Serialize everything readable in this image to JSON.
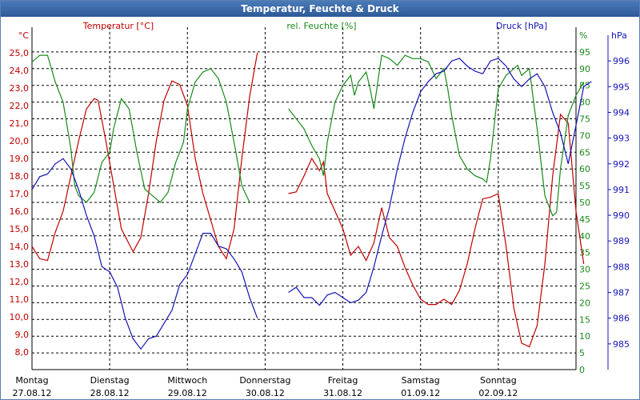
{
  "title": "Temperatur, Feuchte & Druck",
  "colors": {
    "temperature": "#c00000",
    "humidity": "#1a8a1a",
    "pressure": "#1414b4",
    "grid": "#000000",
    "text": "#000000"
  },
  "chart_data": {
    "type": "line",
    "title": "Temperatur, Feuchte & Druck",
    "x_categories": [
      {
        "day": "Montag",
        "date": "27.08.12"
      },
      {
        "day": "Dienstag",
        "date": "28.08.12"
      },
      {
        "day": "Mittwoch",
        "date": "29.08.12"
      },
      {
        "day": "Donnerstag",
        "date": "30.08.12"
      },
      {
        "day": "Freitag",
        "date": "31.08.12"
      },
      {
        "day": "Samstag",
        "date": "01.09.12"
      },
      {
        "day": "Sonntag",
        "date": "02.09.12"
      }
    ],
    "x_unit": "days since Montag 27.08.12 00:00",
    "axes": {
      "temperature": {
        "label": "Temperatur [°C]",
        "unit": "°C",
        "range": [
          7.0,
          26.0
        ],
        "ticks": [
          "8,0",
          "9,0",
          "10,0",
          "11,0",
          "12,0",
          "13,0",
          "14,0",
          "15,0",
          "16,0",
          "17,0",
          "18,0",
          "19,0",
          "20,0",
          "21,0",
          "22,0",
          "23,0",
          "24,0",
          "25,0"
        ]
      },
      "humidity": {
        "label": "rel. Feuchte [%]",
        "unit": "%",
        "range": [
          0,
          100
        ],
        "ticks": [
          "0",
          "5",
          "10",
          "15",
          "20",
          "25",
          "30",
          "35",
          "40",
          "45",
          "50",
          "55",
          "60",
          "65",
          "70",
          "75",
          "80",
          "85",
          "90",
          "95"
        ]
      },
      "pressure": {
        "label": "Druck [hPa]",
        "unit": "hPa",
        "range": [
          984.0,
          997.0
        ],
        "ticks": [
          "985",
          "986",
          "987",
          "988",
          "989",
          "990",
          "991",
          "992",
          "993",
          "994",
          "995",
          "996"
        ]
      }
    },
    "series": [
      {
        "name": "Temperatur [°C]",
        "axis": "temperature",
        "segments": [
          [
            [
              0,
              14.0
            ],
            [
              0.1,
              13.3
            ],
            [
              0.2,
              13.2
            ],
            [
              0.3,
              14.8
            ],
            [
              0.4,
              16.0
            ],
            [
              0.5,
              18.0
            ],
            [
              0.6,
              20.0
            ],
            [
              0.7,
              21.8
            ],
            [
              0.8,
              22.4
            ],
            [
              0.85,
              22.3
            ],
            [
              0.95,
              20.0
            ],
            [
              1.05,
              17.5
            ],
            [
              1.15,
              15.0
            ],
            [
              1.3,
              13.7
            ],
            [
              1.4,
              14.5
            ],
            [
              1.5,
              17.0
            ],
            [
              1.6,
              20.0
            ],
            [
              1.7,
              22.3
            ],
            [
              1.8,
              23.4
            ],
            [
              1.9,
              23.2
            ],
            [
              2.0,
              22.0
            ],
            [
              2.1,
              19.0
            ],
            [
              2.2,
              17.0
            ],
            [
              2.3,
              15.5
            ],
            [
              2.4,
              14.0
            ],
            [
              2.5,
              13.3
            ],
            [
              2.6,
              15.0
            ],
            [
              2.7,
              19.0
            ],
            [
              2.8,
              22.5
            ],
            [
              2.9,
              25.0
            ]
          ],
          [
            [
              3.3,
              17.0
            ],
            [
              3.4,
              17.1
            ],
            [
              3.5,
              18.0
            ],
            [
              3.6,
              19.0
            ],
            [
              3.7,
              18.3
            ],
            [
              3.75,
              18.8
            ],
            [
              3.8,
              17.0
            ],
            [
              3.9,
              16.0
            ],
            [
              4.0,
              15.0
            ],
            [
              4.1,
              13.5
            ],
            [
              4.2,
              14.0
            ],
            [
              4.3,
              13.2
            ],
            [
              4.4,
              14.2
            ],
            [
              4.5,
              16.2
            ],
            [
              4.6,
              14.5
            ],
            [
              4.7,
              14.0
            ],
            [
              4.8,
              12.8
            ],
            [
              4.9,
              11.8
            ],
            [
              5.0,
              11.0
            ],
            [
              5.1,
              10.7
            ],
            [
              5.2,
              10.7
            ],
            [
              5.3,
              11.0
            ],
            [
              5.4,
              10.7
            ],
            [
              5.5,
              11.5
            ],
            [
              5.6,
              13.0
            ],
            [
              5.7,
              15.0
            ],
            [
              5.8,
              16.7
            ],
            [
              5.9,
              16.8
            ],
            [
              6.0,
              17.0
            ],
            [
              6.1,
              14.0
            ],
            [
              6.2,
              10.5
            ],
            [
              6.3,
              8.5
            ],
            [
              6.4,
              8.3
            ],
            [
              6.5,
              9.5
            ],
            [
              6.6,
              13.0
            ],
            [
              6.7,
              18.0
            ],
            [
              6.8,
              21.5
            ],
            [
              6.9,
              21.0
            ],
            [
              7.0,
              16.0
            ],
            [
              7.1,
              13.0
            ]
          ]
        ]
      },
      {
        "name": "rel. Feuchte [%]",
        "axis": "humidity",
        "segments": [
          [
            [
              0,
              92
            ],
            [
              0.1,
              94
            ],
            [
              0.2,
              94
            ],
            [
              0.3,
              86
            ],
            [
              0.4,
              80
            ],
            [
              0.5,
              66
            ],
            [
              0.55,
              55
            ],
            [
              0.6,
              52
            ],
            [
              0.7,
              50
            ],
            [
              0.8,
              53
            ],
            [
              0.9,
              62
            ],
            [
              1.0,
              65
            ],
            [
              1.05,
              72
            ],
            [
              1.15,
              81
            ],
            [
              1.25,
              78
            ],
            [
              1.35,
              65
            ],
            [
              1.45,
              54
            ],
            [
              1.55,
              52
            ],
            [
              1.65,
              50
            ],
            [
              1.75,
              53
            ],
            [
              1.85,
              62
            ],
            [
              1.95,
              68
            ],
            [
              2.0,
              78
            ],
            [
              2.1,
              86
            ],
            [
              2.2,
              89
            ],
            [
              2.3,
              90
            ],
            [
              2.4,
              87
            ],
            [
              2.5,
              80
            ],
            [
              2.6,
              68
            ],
            [
              2.7,
              55
            ],
            [
              2.8,
              50
            ]
          ],
          [
            [
              3.3,
              78
            ],
            [
              3.4,
              75
            ],
            [
              3.5,
              72
            ],
            [
              3.6,
              67
            ],
            [
              3.7,
              63
            ],
            [
              3.75,
              58
            ],
            [
              3.8,
              68
            ],
            [
              3.9,
              80
            ],
            [
              4.0,
              85
            ],
            [
              4.1,
              88
            ],
            [
              4.15,
              82
            ],
            [
              4.2,
              86
            ],
            [
              4.3,
              89
            ],
            [
              4.35,
              84
            ],
            [
              4.4,
              78
            ],
            [
              4.5,
              94
            ],
            [
              4.6,
              93
            ],
            [
              4.7,
              91
            ],
            [
              4.8,
              94
            ],
            [
              4.9,
              93
            ],
            [
              5.0,
              93
            ],
            [
              5.1,
              92
            ],
            [
              5.2,
              87
            ],
            [
              5.3,
              90
            ],
            [
              5.35,
              84
            ],
            [
              5.4,
              76
            ],
            [
              5.5,
              64
            ],
            [
              5.6,
              60
            ],
            [
              5.7,
              58
            ],
            [
              5.8,
              57
            ],
            [
              5.85,
              56
            ],
            [
              5.9,
              63
            ],
            [
              6.0,
              84
            ],
            [
              6.1,
              88
            ],
            [
              6.2,
              90
            ],
            [
              6.25,
              91
            ],
            [
              6.3,
              88
            ],
            [
              6.4,
              90
            ],
            [
              6.5,
              72
            ],
            [
              6.6,
              52
            ],
            [
              6.7,
              46
            ],
            [
              6.75,
              47
            ],
            [
              6.8,
              60
            ],
            [
              6.9,
              76
            ],
            [
              7.0,
              82
            ],
            [
              7.1,
              86
            ]
          ]
        ]
      },
      {
        "name": "Druck [hPa]",
        "axis": "pressure",
        "segments": [
          [
            [
              0,
              991.0
            ],
            [
              0.1,
              991.5
            ],
            [
              0.2,
              991.6
            ],
            [
              0.3,
              992.0
            ],
            [
              0.4,
              992.2
            ],
            [
              0.5,
              991.8
            ],
            [
              0.6,
              991.0
            ],
            [
              0.7,
              990.0
            ],
            [
              0.8,
              989.2
            ],
            [
              0.9,
              988.0
            ],
            [
              1.0,
              987.8
            ],
            [
              1.1,
              987.2
            ],
            [
              1.2,
              986.0
            ],
            [
              1.3,
              985.2
            ],
            [
              1.4,
              984.8
            ],
            [
              1.5,
              985.2
            ],
            [
              1.6,
              985.3
            ],
            [
              1.7,
              985.8
            ],
            [
              1.8,
              986.3
            ],
            [
              1.9,
              987.3
            ],
            [
              2.0,
              987.7
            ],
            [
              2.1,
              988.5
            ],
            [
              2.2,
              989.3
            ],
            [
              2.3,
              989.3
            ],
            [
              2.4,
              988.8
            ],
            [
              2.5,
              988.7
            ],
            [
              2.6,
              988.3
            ],
            [
              2.7,
              987.8
            ],
            [
              2.8,
              986.8
            ],
            [
              2.9,
              986.0
            ]
          ],
          [
            [
              3.3,
              987.0
            ],
            [
              3.4,
              987.2
            ],
            [
              3.5,
              986.8
            ],
            [
              3.6,
              986.8
            ],
            [
              3.7,
              986.5
            ],
            [
              3.8,
              986.9
            ],
            [
              3.9,
              987.0
            ],
            [
              4.0,
              986.8
            ],
            [
              4.1,
              986.6
            ],
            [
              4.2,
              986.7
            ],
            [
              4.3,
              987.0
            ],
            [
              4.4,
              988.0
            ],
            [
              4.5,
              989.2
            ],
            [
              4.6,
              990.3
            ],
            [
              4.7,
              991.8
            ],
            [
              4.8,
              993.0
            ],
            [
              4.9,
              994.0
            ],
            [
              5.0,
              994.8
            ],
            [
              5.1,
              995.2
            ],
            [
              5.2,
              995.5
            ],
            [
              5.3,
              995.6
            ],
            [
              5.4,
              996.0
            ],
            [
              5.5,
              996.1
            ],
            [
              5.6,
              995.8
            ],
            [
              5.7,
              995.6
            ],
            [
              5.8,
              995.5
            ],
            [
              5.9,
              996.0
            ],
            [
              6.0,
              996.1
            ],
            [
              6.1,
              995.8
            ],
            [
              6.2,
              995.3
            ],
            [
              6.3,
              995.0
            ],
            [
              6.4,
              995.3
            ],
            [
              6.5,
              995.5
            ],
            [
              6.6,
              995.0
            ],
            [
              6.7,
              994.0
            ],
            [
              6.8,
              993.2
            ],
            [
              6.9,
              992.0
            ],
            [
              7.0,
              993.5
            ],
            [
              7.1,
              995.0
            ],
            [
              7.2,
              995.2
            ]
          ]
        ]
      }
    ],
    "grid": true
  }
}
